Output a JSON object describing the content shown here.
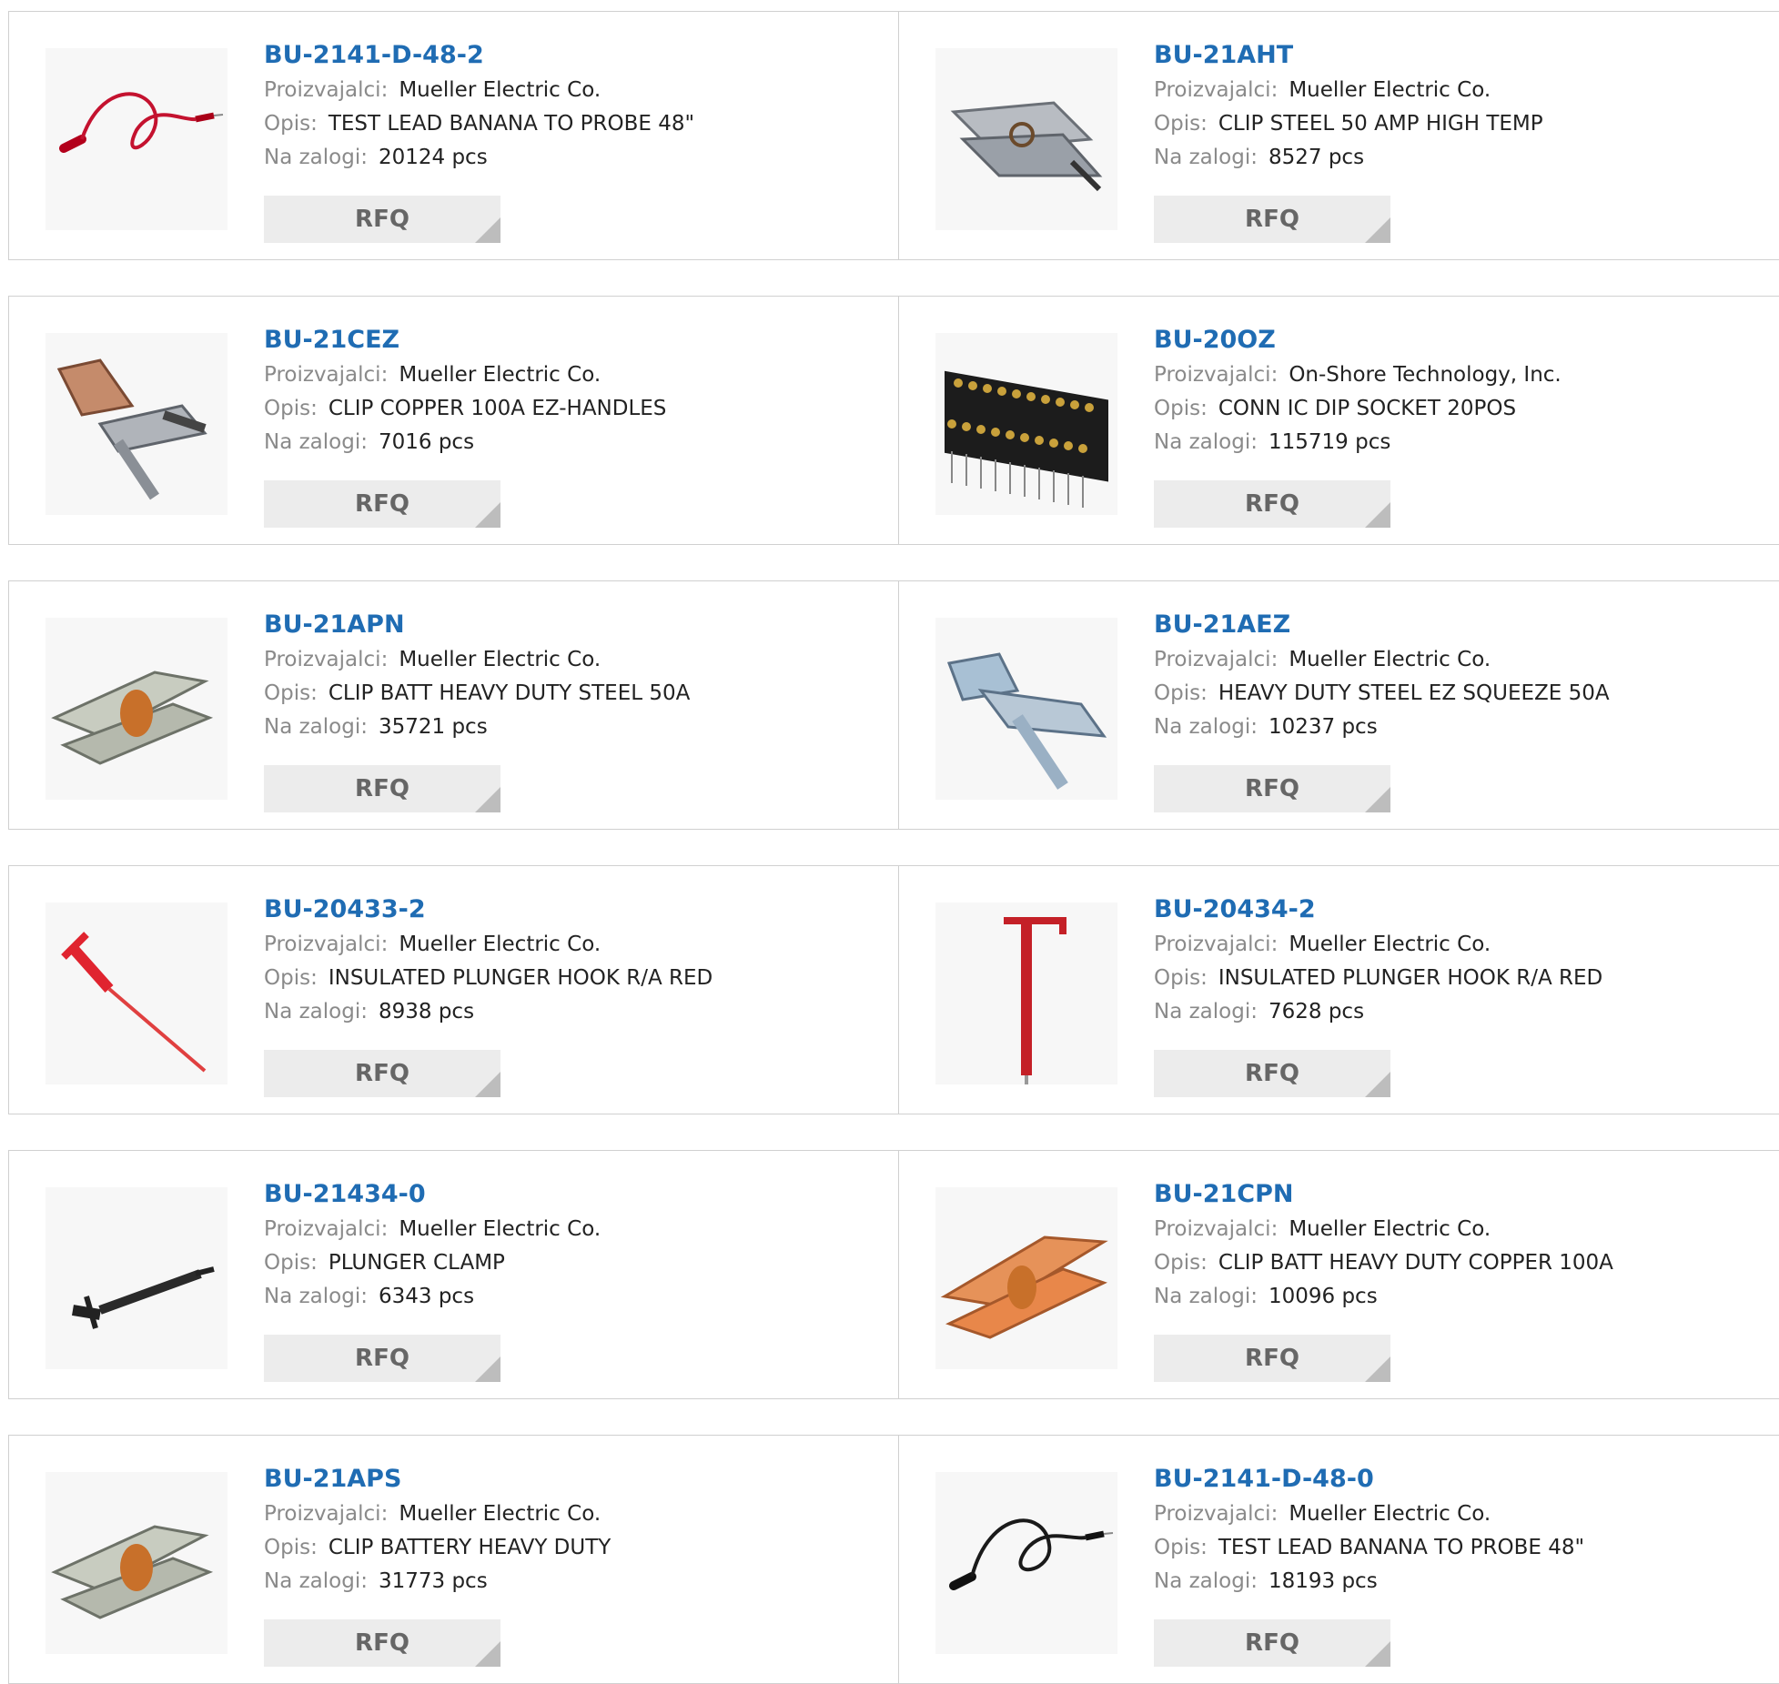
{
  "labels": {
    "manufacturer": "Proizvajalci:",
    "description": "Opis:",
    "stock": "Na zalogi:",
    "rfq": "RFQ"
  },
  "colors": {
    "part_link": "#1f6cb3",
    "rfq_bg": "#ececec"
  },
  "products": [
    {
      "part": "BU-2141-D-48-2",
      "manufacturer": "Mueller Electric Co.",
      "description": "TEST LEAD BANANA TO PROBE 48\"",
      "stock": "20124 pcs",
      "icon": "test-lead-red-icon"
    },
    {
      "part": "BU-21AHT",
      "manufacturer": "Mueller Electric Co.",
      "description": "CLIP STEEL 50 AMP HIGH TEMP",
      "stock": "8527 pcs",
      "icon": "steel-clip-icon"
    },
    {
      "part": "BU-21CEZ",
      "manufacturer": "Mueller Electric Co.",
      "description": "CLIP COPPER 100A EZ-HANDLES",
      "stock": "7016 pcs",
      "icon": "copper-ez-clip-icon"
    },
    {
      "part": "BU-20OZ",
      "manufacturer": "On-Shore Technology, Inc.",
      "description": "CONN IC DIP SOCKET 20POS",
      "stock": "115719 pcs",
      "icon": "dip-socket-icon"
    },
    {
      "part": "BU-21APN",
      "manufacturer": "Mueller Electric Co.",
      "description": "CLIP BATT HEAVY DUTY STEEL 50A",
      "stock": "35721 pcs",
      "icon": "battery-clip-icon"
    },
    {
      "part": "BU-21AEZ",
      "manufacturer": "Mueller Electric Co.",
      "description": "HEAVY DUTY STEEL EZ SQUEEZE 50A",
      "stock": "10237 pcs",
      "icon": "ez-squeeze-clip-icon"
    },
    {
      "part": "BU-20433-2",
      "manufacturer": "Mueller Electric Co.",
      "description": "INSULATED PLUNGER HOOK R/A RED",
      "stock": "8938 pcs",
      "icon": "plunger-hook-ra-icon"
    },
    {
      "part": "BU-20434-2",
      "manufacturer": "Mueller Electric Co.",
      "description": "INSULATED PLUNGER HOOK R/A RED",
      "stock": "7628 pcs",
      "icon": "plunger-hook-icon"
    },
    {
      "part": "BU-21434-0",
      "manufacturer": "Mueller Electric Co.",
      "description": "PLUNGER CLAMP",
      "stock": "6343 pcs",
      "icon": "plunger-clamp-black-icon"
    },
    {
      "part": "BU-21CPN",
      "manufacturer": "Mueller Electric Co.",
      "description": "CLIP BATT HEAVY DUTY COPPER 100A",
      "stock": "10096 pcs",
      "icon": "copper-battery-clip-icon"
    },
    {
      "part": "BU-21APS",
      "manufacturer": "Mueller Electric Co.",
      "description": "CLIP BATTERY HEAVY DUTY",
      "stock": "31773 pcs",
      "icon": "battery-clip-icon"
    },
    {
      "part": "BU-2141-D-48-0",
      "manufacturer": "Mueller Electric Co.",
      "description": "TEST LEAD BANANA TO PROBE 48\"",
      "stock": "18193 pcs",
      "icon": "test-lead-black-icon"
    }
  ]
}
